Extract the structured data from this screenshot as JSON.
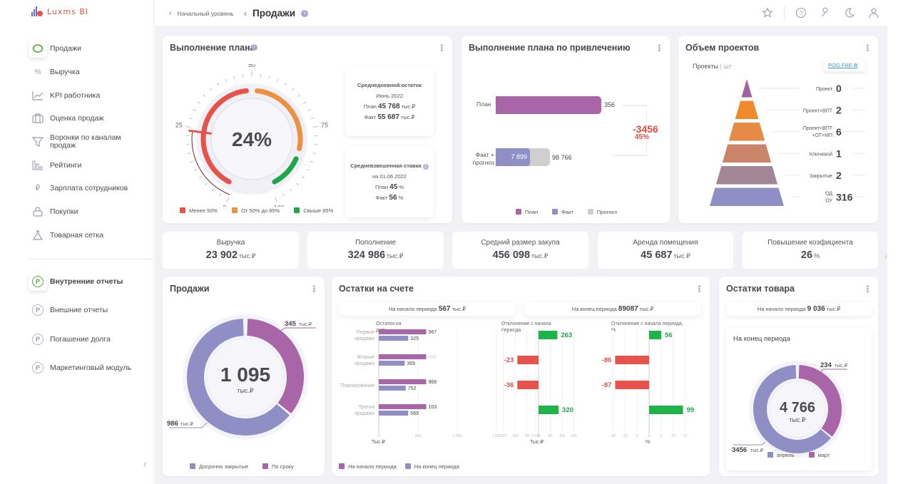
{
  "app": {
    "logo_text": "Luxms BI"
  },
  "sidebar": {
    "items": [
      {
        "label": "Продажи",
        "icon": "piggy-bank-icon",
        "active": true
      },
      {
        "label": "Выручка",
        "icon": "percent-icon"
      },
      {
        "label": "KPI работника",
        "icon": "line-chart-icon"
      },
      {
        "label": "Оценка продаж",
        "icon": "briefcase-icon"
      },
      {
        "label": "Воронки по каналам продаж",
        "icon": "funnel-icon"
      },
      {
        "label": "Рейтинги",
        "icon": "bar-chart-icon"
      },
      {
        "label": "Зарплата сотрудников",
        "icon": "ruble-icon"
      },
      {
        "label": "Покупки",
        "icon": "lock-icon"
      },
      {
        "label": "Товарная сетка",
        "icon": "flask-icon"
      }
    ],
    "reports": [
      {
        "label": "Внутренние отчеты",
        "icon": "ruble-circle-icon",
        "active": true
      },
      {
        "label": "Внешние отчеты",
        "icon": "ruble-circle-icon"
      },
      {
        "label": "Погашение долга",
        "icon": "ruble-circle-icon"
      },
      {
        "label": "Маркетинговый модуль",
        "icon": "ruble-circle-icon"
      }
    ]
  },
  "header": {
    "breadcrumb_root": "Начальный уровень",
    "title": "Продажи",
    "icons": [
      "star-icon",
      "help-icon",
      "wrench-icon",
      "theme-icon",
      "user-icon"
    ]
  },
  "plan": {
    "title": "Выполнение плана",
    "value_label": "24%",
    "value": 24,
    "ticks": [
      "0",
      "25",
      "50",
      "75",
      "100"
    ],
    "legend": [
      {
        "label": "Менее 50%",
        "color": "#e8524a"
      },
      {
        "label": "От 50% до 85%",
        "color": "#ec9142"
      },
      {
        "label": "Свыше 85%",
        "color": "#1fa64a"
      }
    ],
    "daily": {
      "title": "Среднедневной остаток",
      "period": "Июнь 2022",
      "plan_label": "План",
      "plan_value": "45 768",
      "fact_label": "Факт",
      "fact_value": "55 687",
      "unit": "тыс.₽"
    },
    "rate": {
      "title": "Средневзвешенная ставка",
      "date": "на 01.06.2022",
      "plan_label": "План",
      "plan_value": "45",
      "fact_label": "Факт",
      "fact_value": "56",
      "unit": "%"
    }
  },
  "attraction": {
    "title": "Выполнение плана по привлечению",
    "plan_label": "План",
    "plan_value": "356",
    "fact_label": "Факт +\nпрогноз",
    "fact_value": "7 899",
    "forecast_value": "98 766",
    "diff_value": "-3456",
    "diff_percent": "45%",
    "legend": [
      {
        "label": "План",
        "color": "#a866a8"
      },
      {
        "label": "Факт",
        "color": "#8f8fc6"
      },
      {
        "label": "Прогноз",
        "color": "#cfcfcf"
      }
    ]
  },
  "projects": {
    "title": "Объем проектов",
    "subtitle": "Проекты",
    "unit": "шт",
    "link_label": "POG FRE",
    "levels": [
      {
        "label": "Проект",
        "value": "0"
      },
      {
        "label": "Проект+ВПТ",
        "value": "2"
      },
      {
        "label": "Проект+ВПТ +ОТ+МП",
        "value": "6"
      },
      {
        "label": "Ключевой",
        "value": "1"
      },
      {
        "label": "Закрытые",
        "value": "2"
      },
      {
        "label": "ОД ОУ",
        "value": "316"
      }
    ]
  },
  "kpis": [
    {
      "label": "Выручка",
      "value": "23 902",
      "unit": "тыс.₽"
    },
    {
      "label": "Пополнение",
      "value": "324 986",
      "unit": "тыс.₽"
    },
    {
      "label": "Средний размер закупа",
      "value": "456 098",
      "unit": "тыс.₽"
    },
    {
      "label": "Аренда помещения",
      "value": "45 687",
      "unit": "тыс.₽"
    },
    {
      "label": "Повышение коэфициента",
      "value": "26",
      "unit": "%"
    }
  ],
  "sales": {
    "title": "Продажи",
    "total": "1 095",
    "unit": "тыс.₽",
    "segments": [
      {
        "label": "Досрочно закрытые",
        "value": 986,
        "value_label": "986",
        "color": "#8f8fc6"
      },
      {
        "label": "По сроку",
        "value": 345,
        "value_label": "345",
        "color": "#a866a8"
      }
    ]
  },
  "account": {
    "title": "Остатки на счете",
    "start_label": "На начало периода",
    "start_value": "567",
    "end_label": "На конец периода",
    "end_value": "89087",
    "unit": "тыс.₽",
    "legend": [
      {
        "label": "На начало периода",
        "color": "#a866a8"
      },
      {
        "label": "На конец периода",
        "color": "#8f8fc6"
      }
    ]
  },
  "goods": {
    "title": "Остатки товара",
    "start_label": "На начало периода",
    "start_value": "9 036",
    "unit": "тыс.₽",
    "end_title": "На конец периода",
    "total": "4 766",
    "segments": [
      {
        "label": "апрель",
        "value": 3456,
        "value_label": "3456",
        "color": "#8f8fc6"
      },
      {
        "label": "март",
        "value": 234,
        "value_label": "234",
        "color": "#a866a8"
      }
    ]
  },
  "chart_data": [
    {
      "type": "bar",
      "title": "Остатки на дату",
      "orientation": "horizontal",
      "categories": [
        "Первые продажи",
        "Вторые продажи",
        "Планирование",
        "Третьи продажи"
      ],
      "series": [
        {
          "name": "На начало периода",
          "values": [
            567,
            456,
            968,
            103
          ],
          "bar_lengths": [
            950,
            950,
            950,
            950
          ]
        },
        {
          "name": "На конец периода",
          "values": [
            325,
            369,
            752,
            569
          ],
          "bar_lengths": [
            590,
            520,
            540,
            590
          ]
        }
      ],
      "xlabel": "Тыс.₽",
      "xticks": [
        "0",
        "500",
        "1 000",
        "1 500",
        "2 000"
      ],
      "xlim": [
        0,
        2000
      ]
    },
    {
      "type": "bar",
      "title": "Отклонение с начала периода",
      "orientation": "horizontal",
      "categories": [
        "Первые продажи",
        "Вторые продажи",
        "Планирование",
        "Третьи продажи"
      ],
      "values": [
        263,
        -23,
        -36,
        320
      ],
      "bar_lengths": [
        80,
        -90,
        -90,
        85
      ],
      "xlabel": "Тыс.₽",
      "xticks": [
        "-150",
        "-100",
        "-50",
        "0",
        "50",
        "100",
        "150"
      ],
      "xlim": [
        -150,
        150
      ]
    },
    {
      "type": "bar",
      "title": "Отклонение с начала периода, %",
      "orientation": "horizontal",
      "categories": [
        "Первые продажи",
        "Вторые продажи",
        "Планирование",
        "Третьи продажи"
      ],
      "values": [
        56,
        -86,
        -87,
        99
      ],
      "bar_lengths": [
        5,
        -14,
        -14,
        14
      ],
      "xlabel": "%",
      "xticks": [
        "-15",
        "-10",
        "-5",
        "0",
        "5",
        "10",
        "15"
      ],
      "xlim": [
        -15,
        15
      ]
    }
  ]
}
